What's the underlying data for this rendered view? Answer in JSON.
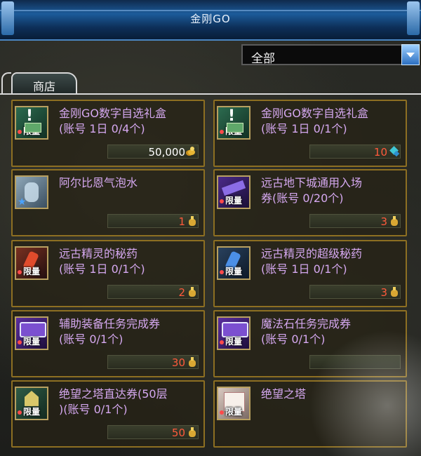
{
  "window": {
    "title": "金刚GO"
  },
  "filter": {
    "selected": "全部"
  },
  "tabs": [
    {
      "label": "商店"
    }
  ],
  "items": [
    {
      "name": "金刚GO数字自选礼盒\n(账号 1日 0/4个)",
      "price": "50,000",
      "price_color": "white",
      "currency_icon": "gold-coin-icon",
      "icon": "gift-box-icon",
      "limited": "限量"
    },
    {
      "name": "金刚GO数字自选礼盒\n(账号 1日 0/1个)",
      "price": "10",
      "price_color": "red",
      "currency_icon": "gem-icon",
      "icon": "gift-box-icon",
      "limited": "限量"
    },
    {
      "name": "阿尔比恩气泡水",
      "price": "1",
      "price_color": "red",
      "currency_icon": "coin-bag-icon",
      "icon": "bubble-water-icon",
      "limited": ""
    },
    {
      "name": "远古地下城通用入场\n券(账号 0/20个)",
      "price": "3",
      "price_color": "red",
      "currency_icon": "coin-bag-icon",
      "icon": "dungeon-ticket-icon",
      "limited": "限量"
    },
    {
      "name": "远古精灵的秘药\n(账号 1日 0/1个)",
      "price": "2",
      "price_color": "red",
      "currency_icon": "coin-bag-icon",
      "icon": "potion-icon",
      "limited": "限量"
    },
    {
      "name": "远古精灵的超级秘药\n(账号 1日 0/1个)",
      "price": "3",
      "price_color": "red",
      "currency_icon": "coin-bag-icon",
      "icon": "super-potion-icon",
      "limited": "限量"
    },
    {
      "name": "辅助装备任务完成券\n(账号 0/1个)",
      "price": "30",
      "price_color": "red",
      "currency_icon": "coin-bag-icon",
      "icon": "quest-ticket-icon",
      "limited": "限量"
    },
    {
      "name": "魔法石任务完成券\n(账号 0/1个)",
      "price": "",
      "price_color": "red",
      "currency_icon": "coin-bag-icon",
      "icon": "quest-ticket-icon",
      "limited": "限量"
    },
    {
      "name": "绝望之塔直达券(50层\n)(账号 0/1个)",
      "price": "50",
      "price_color": "red",
      "currency_icon": "coin-bag-icon",
      "icon": "tower-ticket-icon",
      "limited": "限量"
    },
    {
      "name": "绝望之塔",
      "price": "",
      "price_color": "red",
      "currency_icon": "coin-bag-icon",
      "icon": "scroll-icon",
      "limited": "限量"
    }
  ]
}
